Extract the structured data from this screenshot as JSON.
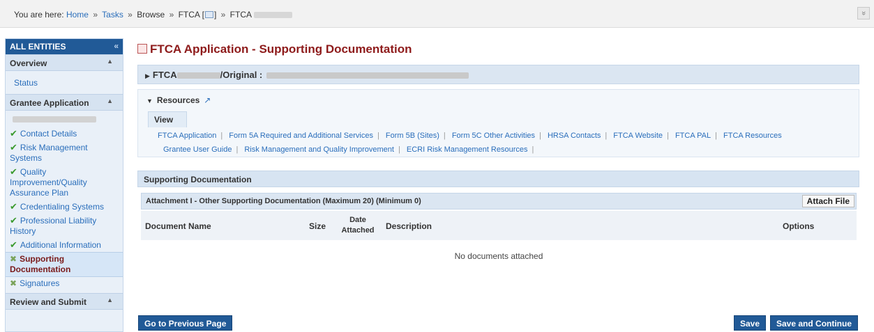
{
  "breadcrumb": {
    "prefix": "You are here:",
    "home": "Home",
    "tasks": "Tasks",
    "browse": "Browse",
    "ftca1": "FTCA [",
    "ftca1_end": "]",
    "ftca2": "FTCA",
    "sep": "»"
  },
  "collapse_toggle": "»",
  "sidebar": {
    "header": "ALL ENTITIES",
    "header_toggle": "«",
    "overview_label": "Overview",
    "status_label": "Status",
    "grantee_label": "Grantee Application",
    "review_label": "Review and Submit",
    "items": [
      {
        "label": "Contact Details",
        "state": "complete"
      },
      {
        "label": "Risk Management Systems",
        "state": "complete"
      },
      {
        "label": "Quality Improvement/Quality Assurance Plan",
        "state": "complete"
      },
      {
        "label": "Credentialing Systems",
        "state": "complete"
      },
      {
        "label": "Professional Liability History",
        "state": "complete"
      },
      {
        "label": "Additional Information",
        "state": "complete"
      },
      {
        "label": "Supporting Documentation",
        "state": "incomplete"
      },
      {
        "label": "Signatures",
        "state": "incomplete"
      }
    ]
  },
  "page": {
    "title": "FTCA Application - Supporting Documentation"
  },
  "ftca_bar": {
    "prefix": "FTCA",
    "original_label": "/Original :"
  },
  "resources": {
    "heading": "Resources",
    "view_tab": "View",
    "links": [
      "FTCA Application",
      "Form 5A Required and Additional Services",
      "Form 5B (Sites)",
      "Form 5C Other Activities",
      "HRSA Contacts",
      "FTCA Website",
      "FTCA PAL",
      "FTCA Resources",
      "Grantee User Guide",
      "Risk Management and Quality Improvement",
      "ECRI Risk Management Resources"
    ]
  },
  "supporting": {
    "heading": "Supporting Documentation",
    "attachment_heading": "Attachment I - Other Supporting Documentation (Maximum 20) (Minimum 0)",
    "attach_button": "Attach File",
    "columns": {
      "name": "Document Name",
      "size": "Size",
      "date": "Date Attached",
      "description": "Description",
      "options": "Options"
    },
    "empty_message": "No documents attached"
  },
  "buttons": {
    "previous": "Go to Previous Page",
    "save": "Save",
    "save_continue": "Save and Continue"
  },
  "colors": {
    "accent": "#215a97",
    "title": "#8e1b1b",
    "link": "#2a6ebb",
    "check": "#3a9a2e"
  }
}
